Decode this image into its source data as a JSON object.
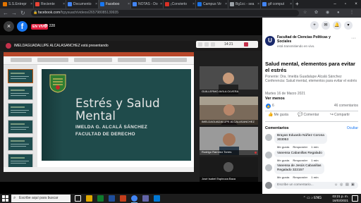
{
  "browser": {
    "tabs": [
      {
        "label": "S.S.Entrepr",
        "color": "#e37400"
      },
      {
        "label": "Reciente",
        "color": "#ea4335"
      },
      {
        "label": "Documento",
        "color": "#4285f4"
      },
      {
        "label": "Faceboo",
        "color": "#1877f2"
      },
      {
        "label": "NOTAS - Do",
        "color": "#4285f4"
      },
      {
        "label": "¡Convierto",
        "color": "#d93025"
      },
      {
        "label": "Campus Vir",
        "color": "#1a73e8"
      },
      {
        "label": "Bg1cc - sea",
        "color": "#9aa0a6"
      },
      {
        "label": "gif comput",
        "color": "#4285f4"
      }
    ],
    "new_tab": "+",
    "url_host": "facebook.com",
    "url_path": "/fcpysuach/videos/265798085139935",
    "back": "←",
    "forward": "→",
    "reload": "↻"
  },
  "video": {
    "close": "×",
    "live_label": "EN VIVO",
    "viewers": "228",
    "meeting_time": "14:21",
    "presenting": "IMELDAGUADALUPE ALCALASANCHEZ está presentando",
    "menu_text": "IMELDAGUADALUPE ALCALASANCHEZ está presentando",
    "slide": {
      "title_line1": "Estrés y Salud",
      "title_line2": "Mental",
      "author": "IMELDA G. ALCALÁ SÁNCHEZ",
      "faculty": "FACULTAD DE DERECHO"
    },
    "participants": [
      {
        "name": "GUILLERMO AVILA OLVERA"
      },
      {
        "name": "IMELDAGUADALUPE ALCALASANCHEZ"
      },
      {
        "name": "Rodrigo Ramírez Torres"
      },
      {
        "name": "José Isabel Espinoza Baca"
      }
    ]
  },
  "facebook": {
    "page_name": "Facultad de Ciencias Políticas y Sociales",
    "page_sub": "está transmitiendo en vivo.",
    "post_title": "Salud mental, elementos para evitar el estrés",
    "post_body": "Ponente: Dra. Imelda Guadalupe Alcalá Sánchez Conferencia: Salud mental, elementos para evitar el estrés",
    "post_date": "Martes 16 de Marzo 2021",
    "see_less": "Ver menos",
    "reactions": "6",
    "comments_count": "46 comentarios",
    "like": "Me gusta",
    "comment": "Comentar",
    "share": "Compartir",
    "comments_label": "Comentarios",
    "hide": "Ocultar",
    "comment_list": [
      {
        "text_line1": "Brayan Eduardo Núñez Corona",
        "text_line2": "303053",
        "time": "1 min"
      },
      {
        "text_line1": "Vanessa Cabanillas Regalado",
        "text_line2": "",
        "time": "1 min"
      },
      {
        "text_line1": "Vanessa de Jesús Cabanillas",
        "text_line2": "Regalado 322157",
        "time": "1 min"
      }
    ],
    "comment_actions": {
      "like": "Me gusta",
      "reply": "Responder"
    },
    "write_placeholder": "Escribe un comentario..."
  },
  "taskbar": {
    "search_placeholder": "Escribe aquí para buscar",
    "time": "03:21 p. m.",
    "date": "16/03/2021"
  }
}
